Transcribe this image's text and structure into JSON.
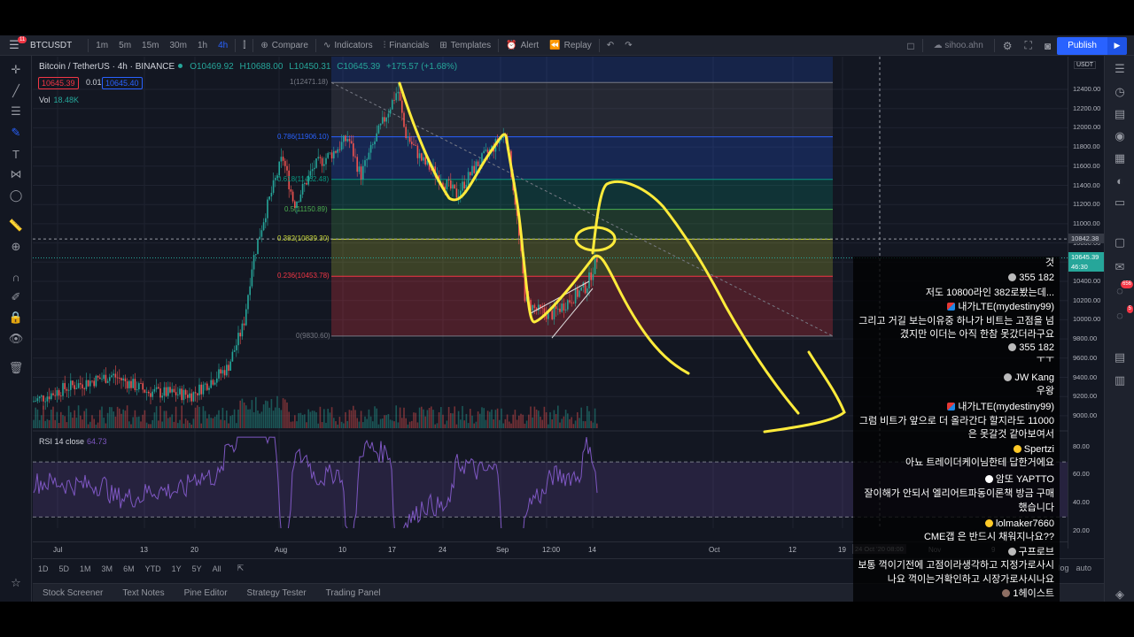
{
  "toolbar": {
    "menu_badge": "11",
    "symbol": "BTCUSDT",
    "intervals": [
      "1m",
      "5m",
      "15m",
      "30m",
      "1h",
      "4h"
    ],
    "active_interval": "4h",
    "compare": "Compare",
    "indicators": "Indicators",
    "financials": "Financials",
    "templates": "Templates",
    "alert": "Alert",
    "replay": "Replay",
    "username": "sihoo.ahn",
    "publish": "Publish"
  },
  "legend": {
    "title": "Bitcoin / TetherUS · 4h · BINANCE",
    "open": "O10469.92",
    "high": "H10688.00",
    "low": "L10450.31",
    "close": "C10645.39",
    "change": "+175.57 (+1.68%)",
    "sell_price": "10645.39",
    "spread": "0.01",
    "buy_price": "10645.40",
    "volume_label": "Vol",
    "volume_value": "18.48K",
    "rsi_label": "RSI 14 close",
    "rsi_value": "64.73"
  },
  "fib_levels": [
    {
      "label": "1(12471.18)",
      "color": "#787b86"
    },
    {
      "label": "0.786(11906.10)",
      "color": "#2962ff"
    },
    {
      "label": "0.618(11462.48)",
      "color": "#089981"
    },
    {
      "label": "0.5(11150.89)",
      "color": "#4caf50"
    },
    {
      "label": "0.382(10839.30)",
      "color": "#cddc39"
    },
    {
      "label": "0.236(10453.78)",
      "color": "#f23645"
    },
    {
      "label": "0(9830.60)",
      "color": "#787b86"
    }
  ],
  "price_axis": {
    "currency": "USDT",
    "labels": [
      "12400.00",
      "12200.00",
      "12000.00",
      "11800.00",
      "11600.00",
      "11400.00",
      "11200.00",
      "11000.00",
      "10800.00",
      "10600.00",
      "10400.00",
      "10200.00",
      "10000.00",
      "9800.00",
      "9600.00",
      "9400.00",
      "9200.00",
      "9000.00"
    ],
    "rsi_labels": [
      "80.00",
      "60.00",
      "40.00",
      "20.00"
    ],
    "crosshair_price": "10842.38",
    "last_price": "10645.39",
    "countdown": "46:30"
  },
  "time_axis": {
    "labels": [
      "Jul",
      "13",
      "20",
      "Aug",
      "10",
      "17",
      "24",
      "Sep",
      "12:00",
      "14",
      "Oct",
      "12",
      "19",
      "Nov",
      "9"
    ],
    "crosshair_time": "24 Oct '20  08:00"
  },
  "ranges": {
    "items": [
      "1D",
      "5D",
      "1M",
      "3M",
      "6M",
      "YTD",
      "1Y",
      "5Y",
      "All"
    ],
    "right_log": "log",
    "right_auto": "auto"
  },
  "bottom_tabs": [
    "Stock Screener",
    "Text Notes",
    "Pine Editor",
    "Strategy Tester",
    "Trading Panel"
  ],
  "right_badges": {
    "notifications": "656",
    "chat": "5"
  },
  "chat": [
    {
      "text": "것",
      "kind": "msg"
    },
    {
      "text": "355 182",
      "kind": "user",
      "mark": "c1"
    },
    {
      "text": "저도 10800라인 382로봤는데...",
      "kind": "msg"
    },
    {
      "text": "내가LTE(mydestiny99)",
      "kind": "user",
      "mark": "c2"
    },
    {
      "text": "그리고 거길 보는이유중 하나가 비트는 고점을 넘",
      "kind": "msg"
    },
    {
      "text": "겼지만 이더는 아직 한참 못갔더라구요",
      "kind": "msg"
    },
    {
      "text": "355 182",
      "kind": "user",
      "mark": "c1"
    },
    {
      "text": "ㅜㅜ",
      "kind": "msg"
    },
    {
      "text": "JW Kang",
      "kind": "user",
      "mark": "c1"
    },
    {
      "text": "우왕",
      "kind": "msg"
    },
    {
      "text": "내가LTE(mydestiny99)",
      "kind": "user",
      "mark": "c2"
    },
    {
      "text": "그럼 비트가 앞으로 더 올라간다 할지라도 11000",
      "kind": "msg"
    },
    {
      "text": "은 못갈것 같아보여서",
      "kind": "msg"
    },
    {
      "text": "Spertzi",
      "kind": "user",
      "mark": "c3"
    },
    {
      "text": "아뇨 트레이더케이님한테 답한거에요",
      "kind": "msg"
    },
    {
      "text": "암또 YAPTTO",
      "kind": "user",
      "mark": "c4"
    },
    {
      "text": "잘이해가 안되서 엘리어트파동이론책 방금 구매",
      "kind": "msg"
    },
    {
      "text": "했습니다",
      "kind": "msg"
    },
    {
      "text": "lolmaker7660",
      "kind": "user",
      "mark": "c3"
    },
    {
      "text": "CME갭 은 반드시 채워지나요??",
      "kind": "msg"
    },
    {
      "text": "구프로브",
      "kind": "user",
      "mark": "c1"
    },
    {
      "text": "보통 꺽이기전에 고점이라생각하고 지정가로사시",
      "kind": "msg"
    },
    {
      "text": "나요 꺽이는거확인하고 시장가로사시나요",
      "kind": "msg"
    },
    {
      "text": "1헤이스트",
      "kind": "user",
      "mark": "c5"
    }
  ],
  "colors": {
    "bg": "#131722",
    "up": "#26a69a",
    "down": "#ef5350",
    "accent": "#2962ff",
    "rsi": "#7e57c2",
    "annotation": "#ffeb3b"
  }
}
